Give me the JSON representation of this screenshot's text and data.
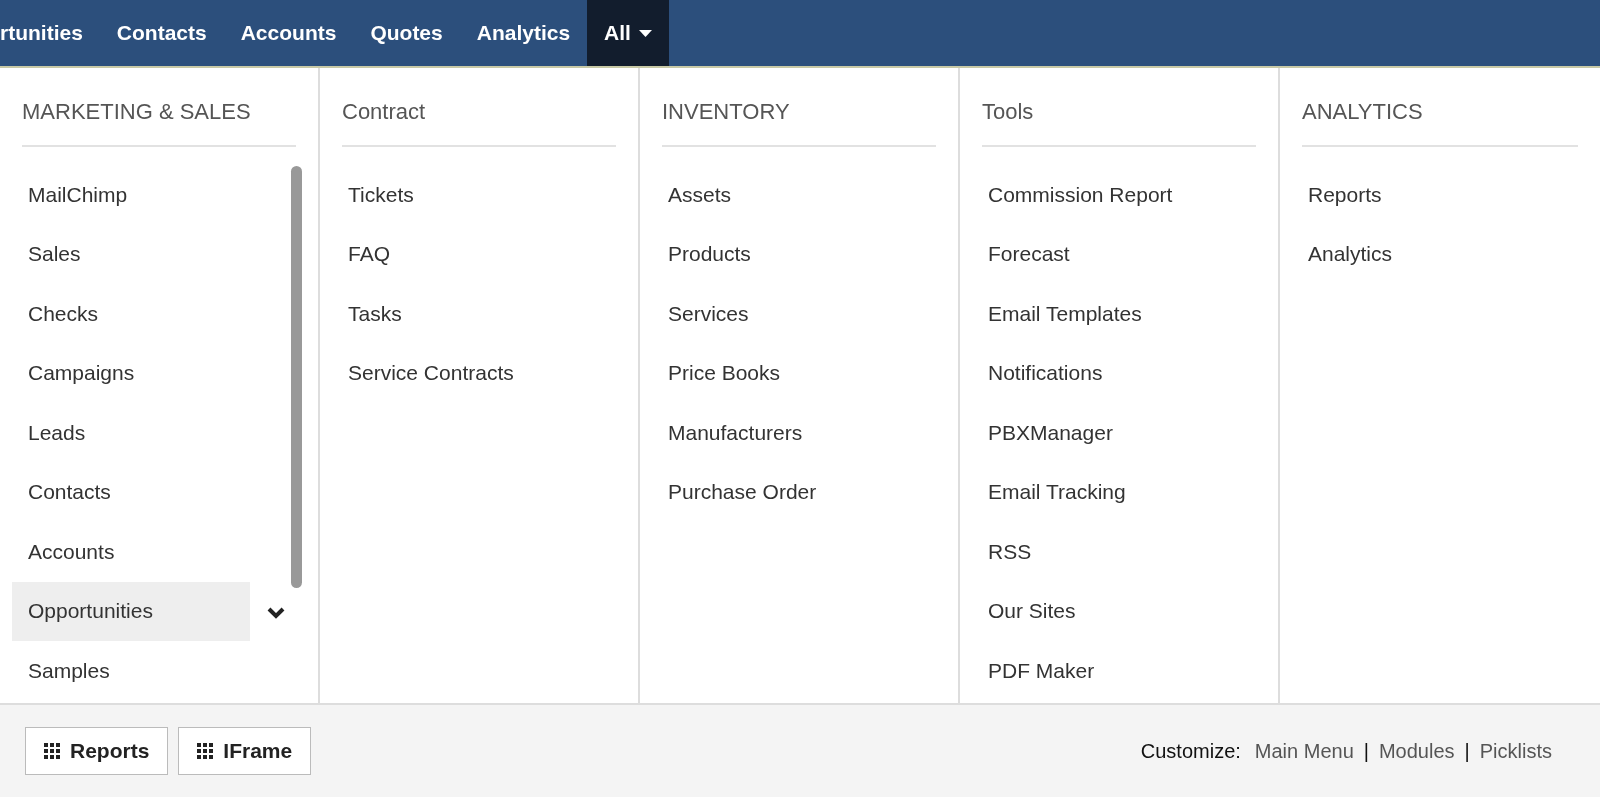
{
  "nav": {
    "items": [
      {
        "label": "rtunities",
        "selected": false,
        "dropdown": false
      },
      {
        "label": "Contacts",
        "selected": false,
        "dropdown": false
      },
      {
        "label": "Accounts",
        "selected": false,
        "dropdown": false
      },
      {
        "label": "Quotes",
        "selected": false,
        "dropdown": false
      },
      {
        "label": "Analytics",
        "selected": false,
        "dropdown": false
      },
      {
        "label": "All",
        "selected": true,
        "dropdown": true
      }
    ]
  },
  "columns": [
    {
      "heading": "MARKETING & SALES",
      "scrollable": true,
      "items": [
        {
          "label": "MailChimp",
          "selected": false
        },
        {
          "label": "Sales",
          "selected": false
        },
        {
          "label": "Checks",
          "selected": false
        },
        {
          "label": "Campaigns",
          "selected": false
        },
        {
          "label": "Leads",
          "selected": false
        },
        {
          "label": "Contacts",
          "selected": false
        },
        {
          "label": "Accounts",
          "selected": false
        },
        {
          "label": "Opportunities",
          "selected": true
        },
        {
          "label": "Samples",
          "selected": false
        }
      ]
    },
    {
      "heading": "Contract",
      "scrollable": false,
      "items": [
        {
          "label": "Tickets",
          "selected": false
        },
        {
          "label": "FAQ",
          "selected": false
        },
        {
          "label": "Tasks",
          "selected": false
        },
        {
          "label": "Service Contracts",
          "selected": false
        }
      ]
    },
    {
      "heading": "INVENTORY",
      "scrollable": false,
      "items": [
        {
          "label": "Assets",
          "selected": false
        },
        {
          "label": "Products",
          "selected": false
        },
        {
          "label": "Services",
          "selected": false
        },
        {
          "label": "Price Books",
          "selected": false
        },
        {
          "label": "Manufacturers",
          "selected": false
        },
        {
          "label": "Purchase Order",
          "selected": false
        }
      ]
    },
    {
      "heading": "Tools",
      "scrollable": false,
      "items": [
        {
          "label": "Commission Report",
          "selected": false
        },
        {
          "label": "Forecast",
          "selected": false
        },
        {
          "label": "Email Templates",
          "selected": false
        },
        {
          "label": "Notifications",
          "selected": false
        },
        {
          "label": "PBXManager",
          "selected": false
        },
        {
          "label": "Email Tracking",
          "selected": false
        },
        {
          "label": "RSS",
          "selected": false
        },
        {
          "label": "Our Sites",
          "selected": false
        },
        {
          "label": "PDF Maker",
          "selected": false
        }
      ]
    },
    {
      "heading": "ANALYTICS",
      "scrollable": false,
      "items": [
        {
          "label": "Reports",
          "selected": false
        },
        {
          "label": "Analytics",
          "selected": false
        }
      ]
    }
  ],
  "footer": {
    "buttons": [
      "Reports",
      "IFrame"
    ],
    "customize_label": "Customize:",
    "links": [
      "Main Menu",
      "Modules",
      "Picklists"
    ],
    "separators": [
      "|",
      "|"
    ]
  }
}
